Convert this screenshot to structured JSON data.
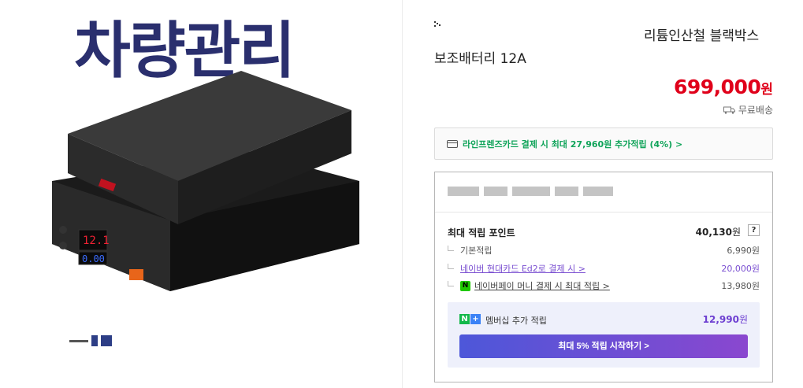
{
  "banner": {
    "text": "차량관리"
  },
  "product": {
    "title_line1": "리튬인산철 블랙박스",
    "title_line2": "보조배터리 12A",
    "price": "699,000",
    "price_unit": "원",
    "shipping": "무료배송"
  },
  "card_promo": {
    "text": "라인프렌즈카드 결제 시 최대 27,960원 추가적립 (4%) >"
  },
  "points": {
    "max_label": "최대 적립 포인트",
    "max_value": "40,130",
    "max_unit": "원",
    "help": "?",
    "rows": [
      {
        "label": "기본적립",
        "value": "6,990원"
      },
      {
        "label": "네이버 현대카드 Ed2로 결제 시 >",
        "value": "20,000원"
      },
      {
        "label": "네이버페이 머니 결제 시 최대 적립 >",
        "value": "13,980원",
        "badge": "N"
      }
    ],
    "membership": {
      "logo_n": "N",
      "logo_plus": "+",
      "label": "멤버십 추가 적립",
      "value": "12,990",
      "unit": "원",
      "button": "최대 5% 적립 시작하기 >"
    }
  },
  "colors": {
    "price": "#e0001a",
    "promo_green": "#10a45a",
    "accent_purple": "#7a4fd1",
    "button_gradient_start": "#4d57d9",
    "button_gradient_end": "#8a47cf"
  }
}
